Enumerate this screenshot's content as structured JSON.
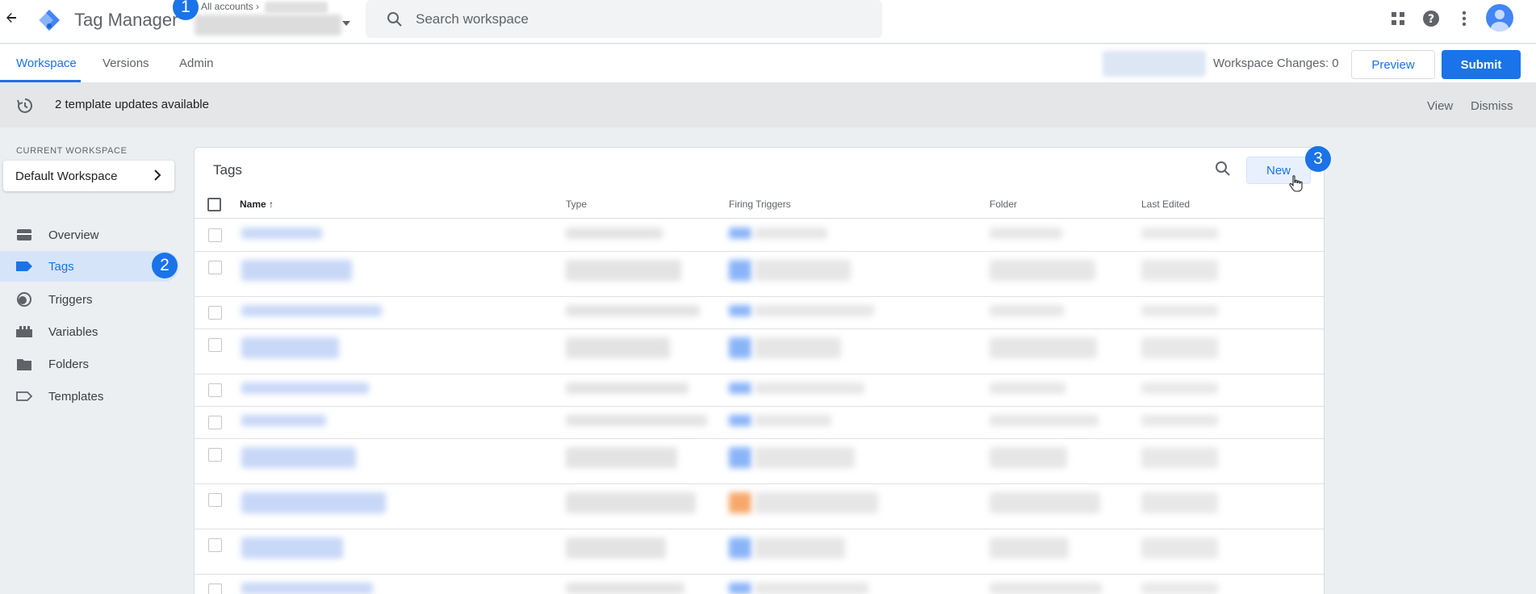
{
  "app": {
    "title": "Tag Manager",
    "accounts_label": "All accounts"
  },
  "search": {
    "placeholder": "Search workspace"
  },
  "steps": {
    "one": "1",
    "two": "2",
    "three": "3"
  },
  "nav": {
    "tabs": [
      {
        "label": "Workspace",
        "active": true
      },
      {
        "label": "Versions",
        "active": false
      },
      {
        "label": "Admin",
        "active": false
      }
    ],
    "workspace_changes": "Workspace Changes: 0",
    "preview_label": "Preview",
    "submit_label": "Submit"
  },
  "updates": {
    "text": "2 template updates available",
    "view_label": "View",
    "dismiss_label": "Dismiss"
  },
  "sidebar": {
    "current_workspace_label": "CURRENT WORKSPACE",
    "workspace_name": "Default Workspace",
    "items": [
      {
        "label": "Overview",
        "icon": "overview-icon",
        "active": false
      },
      {
        "label": "Tags",
        "icon": "tag-icon",
        "active": true
      },
      {
        "label": "Triggers",
        "icon": "trigger-icon",
        "active": false
      },
      {
        "label": "Variables",
        "icon": "variables-icon",
        "active": false
      },
      {
        "label": "Folders",
        "icon": "folder-icon",
        "active": false
      },
      {
        "label": "Templates",
        "icon": "template-icon",
        "active": false
      }
    ]
  },
  "tags": {
    "title": "Tags",
    "new_label": "New",
    "columns": [
      "Name",
      "Type",
      "Firing Triggers",
      "Folder",
      "Last Edited"
    ]
  },
  "colors": {
    "accent": "#1a73e8",
    "active_bg": "#d6e4fa",
    "trigger_orange": "#f6a86b",
    "trigger_blue": "#8ab4f8"
  }
}
